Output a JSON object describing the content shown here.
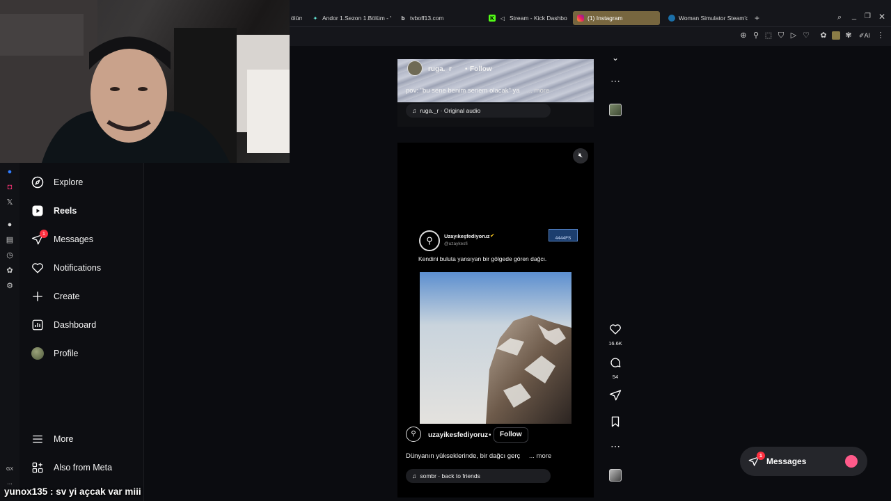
{
  "browser": {
    "tabs": [
      {
        "label": "ölüm",
        "icon": "tab-icon"
      },
      {
        "label": "Andor 1.Sezon 1.Bölüm - Y",
        "icon": "tab-icon"
      },
      {
        "label": "tvboff13.com",
        "icon": "b-icon"
      },
      {
        "label": "Stream - Kick Dashbo",
        "icon": "kick-icon"
      },
      {
        "label": "(1) Instagram",
        "icon": "instagram-icon"
      },
      {
        "label": "Woman Simulator Steam'd",
        "icon": "steam-icon"
      }
    ],
    "new_tab": "+",
    "toolbar_ai": "AI"
  },
  "sidebar_strip": {
    "bottom_label": "GX",
    "dots": "..."
  },
  "nav": {
    "items": [
      {
        "label": "Explore",
        "icon": "compass-icon"
      },
      {
        "label": "Reels",
        "icon": "reels-icon"
      },
      {
        "label": "Messages",
        "icon": "messages-icon",
        "badge": "1"
      },
      {
        "label": "Notifications",
        "icon": "heart-icon"
      },
      {
        "label": "Create",
        "icon": "plus-icon"
      },
      {
        "label": "Dashboard",
        "icon": "dashboard-icon"
      },
      {
        "label": "Profile",
        "icon": "avatar"
      }
    ],
    "more": "More",
    "also_from_meta": "Also from Meta"
  },
  "reel1": {
    "username": "ruga._r",
    "follow": "Follow",
    "caption": "pov: \"bu sene benim senem olacak\" ya",
    "more": "... more",
    "audio": "ruga._r · Original audio"
  },
  "reel2": {
    "tweet": {
      "name": "Uzayıkeşfediyoruz",
      "handle": "@uzaykesfi",
      "text": "Kendini buluta yansıyan bir gölgede gören dağcı.",
      "stamp": "4444FS"
    },
    "username": "uzayikesfediyoruz",
    "dot": "•",
    "follow": "Follow",
    "caption": "Dünyanın yükseklerinde, bir dağcı gerç",
    "more": "... more",
    "audio": "sombr · back to friends"
  },
  "actions": {
    "likes": "16.6K",
    "comments": "54"
  },
  "chat_overlay": {
    "user": "yunox135",
    "message": " : sv yi açcak var miii"
  },
  "messages_button": {
    "label": "Messages",
    "badge": "1"
  },
  "colors": {
    "accent_badge": "#ff3040",
    "active_tab": "#77663f",
    "follow_blue": "#ffffff"
  }
}
